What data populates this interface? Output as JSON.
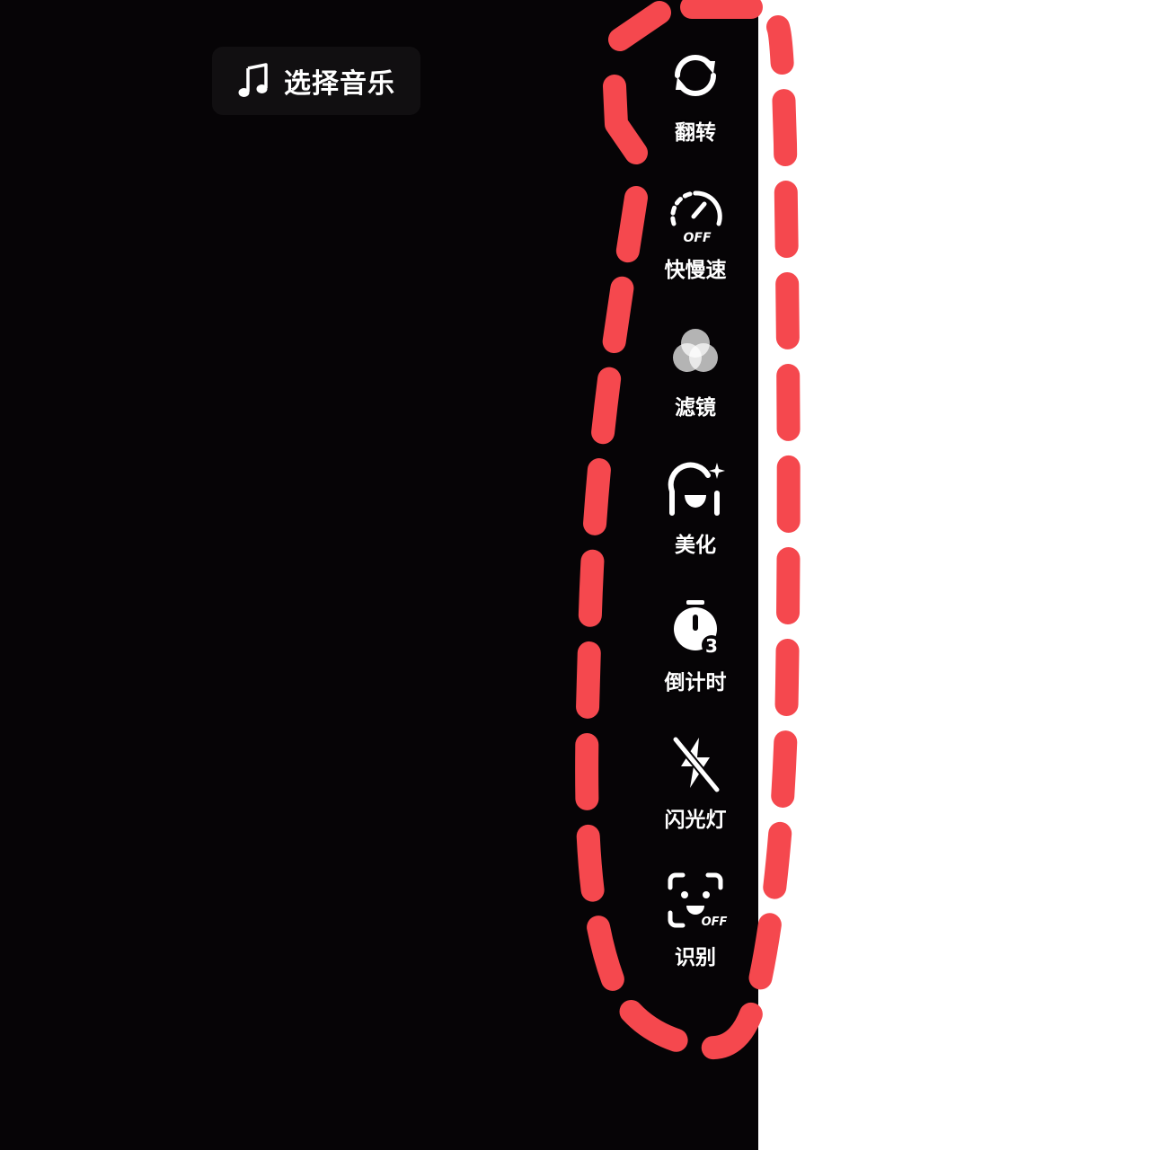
{
  "music": {
    "label": "选择音乐",
    "icon": "music-note-icon"
  },
  "toolbar": {
    "items": [
      {
        "label": "翻转",
        "icon": "flip-camera-icon"
      },
      {
        "label": "快慢速",
        "icon": "speed-off-icon",
        "badge": "OFF"
      },
      {
        "label": "滤镜",
        "icon": "filter-icon"
      },
      {
        "label": "美化",
        "icon": "beautify-icon"
      },
      {
        "label": "倒计时",
        "icon": "countdown-timer-icon",
        "badge": "3"
      },
      {
        "label": "闪光灯",
        "icon": "flash-off-icon"
      },
      {
        "label": "识别",
        "icon": "face-recognition-icon",
        "badge": "OFF"
      }
    ]
  },
  "colors": {
    "background": "#060406",
    "text": "#ffffff",
    "annotation": "#f5484e"
  }
}
